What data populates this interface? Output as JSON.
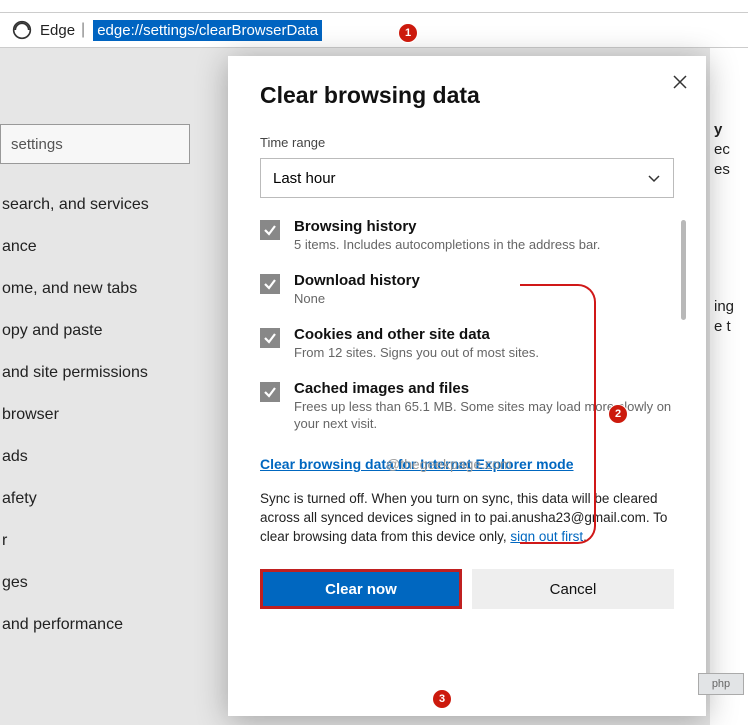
{
  "address": {
    "label": "Edge",
    "url": "edge://settings/clearBrowserData"
  },
  "sidebar": {
    "search_placeholder": "settings",
    "items": [
      "search, and services",
      "ance",
      "ome, and new tabs",
      "opy and paste",
      " and site permissions",
      "browser",
      "ads",
      "afety",
      "r",
      "ges",
      "and performance"
    ]
  },
  "right_fragments": [
    "y",
    "ec",
    "es",
    "ing",
    "e t"
  ],
  "dialog": {
    "title": "Clear browsing data",
    "time_label": "Time range",
    "time_value": "Last hour",
    "items": [
      {
        "title": "Browsing history",
        "sub": "5 items. Includes autocompletions in the address bar."
      },
      {
        "title": "Download history",
        "sub": "None"
      },
      {
        "title": "Cookies and other site data",
        "sub": "From 12 sites. Signs you out of most sites."
      },
      {
        "title": "Cached images and files",
        "sub": "Frees up less than 65.1 MB. Some sites may load more slowly on your next visit."
      }
    ],
    "ie_link": "Clear browsing data for Internet Explorer mode",
    "sync_note_pre": "Sync is turned off. When you turn on sync, this data will be cleared across all synced devices signed in to pai.anusha23@gmail.com. To clear browsing data from this device only, ",
    "sign_out": "sign out first",
    "clear_btn": "Clear now",
    "cancel_btn": "Cancel"
  },
  "markers": {
    "m1": "1",
    "m2": "2",
    "m3": "3"
  },
  "watermark": "@thegeekpage.com",
  "php": "php"
}
